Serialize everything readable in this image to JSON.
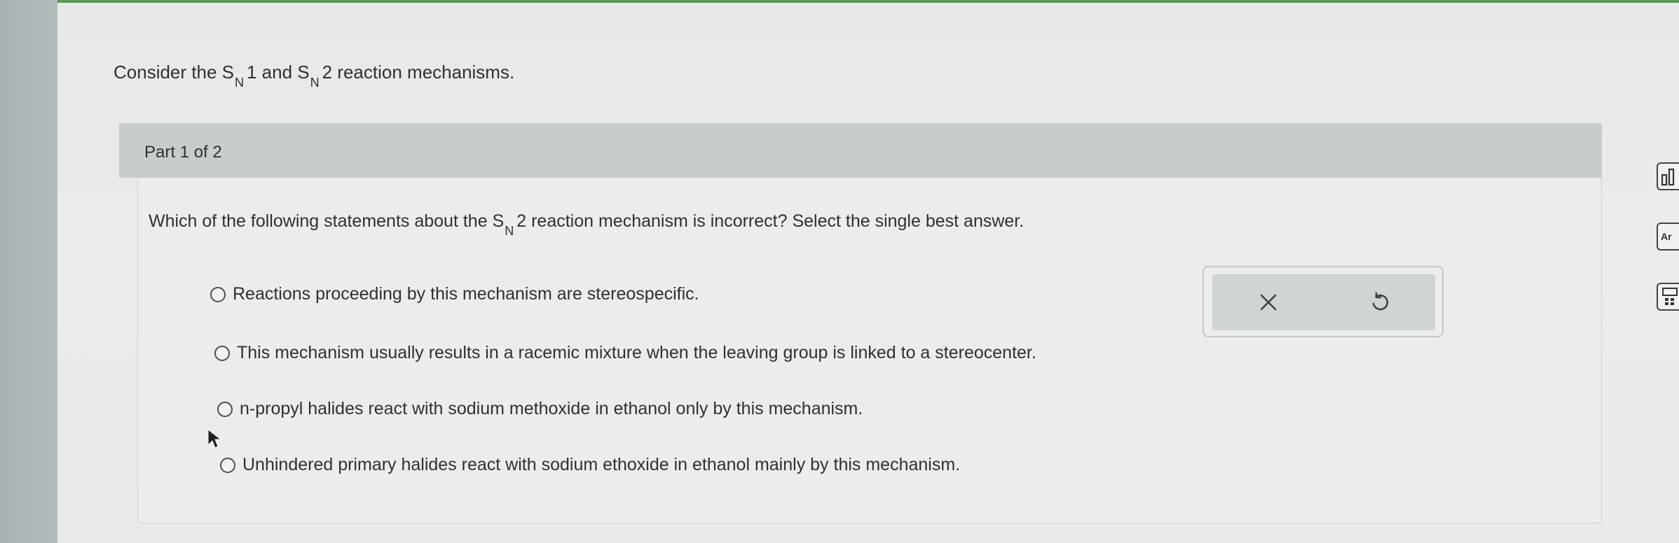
{
  "intro": {
    "prefix": "Consider the S",
    "sub1": "N",
    "mid1": "1 and S",
    "sub2": "N",
    "suffix": "2 reaction mechanisms."
  },
  "part": {
    "label": "Part 1 of 2"
  },
  "question": {
    "prefix": "Which of the following statements about the S",
    "sub": "N",
    "suffix": "2 reaction mechanism is incorrect? Select the single best answer."
  },
  "options": [
    "Reactions proceeding by this mechanism are stereospecific.",
    "This mechanism usually results in a racemic mixture when the leaving group is linked to a stereocenter.",
    "n-propyl halides react with sodium methoxide in ethanol only by this mechanism.",
    "Unhindered primary halides react with sodium ethoxide in ethanol mainly by this mechanism."
  ],
  "toolbox": {
    "clear_icon": "x-icon",
    "reset_icon": "undo-icon"
  },
  "right_tools": [
    {
      "icon": "chart-icon",
      "label": ""
    },
    {
      "icon": "periodic-table-icon",
      "label": "Ar"
    },
    {
      "icon": "calculator-icon",
      "label": ""
    }
  ],
  "colors": {
    "accent": "#5a9a57",
    "header": "#c7cccd",
    "text": "#2d3135"
  }
}
